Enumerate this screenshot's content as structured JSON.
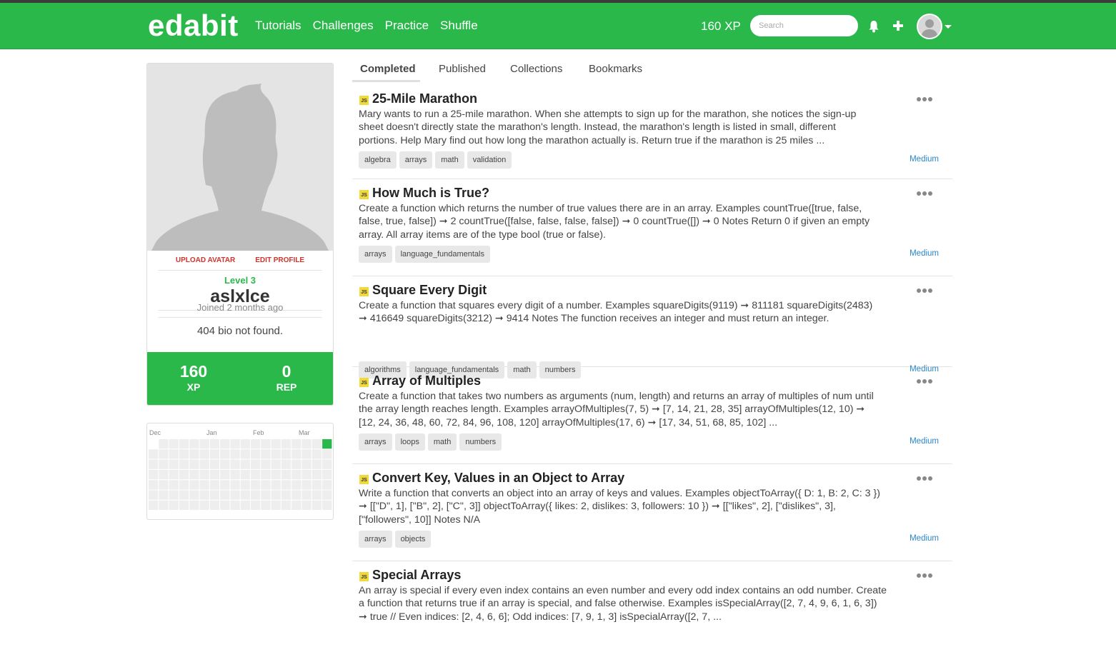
{
  "nav": {
    "logo": "edabit",
    "links": [
      "Tutorials",
      "Challenges",
      "Practice",
      "Shuffle"
    ],
    "xp": "160 XP",
    "search_placeholder": "Search"
  },
  "profile": {
    "upload_avatar": "UPLOAD AVATAR",
    "edit_profile": "EDIT PROFILE",
    "level": "Level 3",
    "username": "aslxlce",
    "joined": "Joined 2 months ago",
    "bio": "404 bio not found.",
    "xp_value": "160",
    "xp_label": "XP",
    "rep_value": "0",
    "rep_label": "REP"
  },
  "activity": {
    "months": [
      "Dec",
      "Jan",
      "Feb",
      "Mar"
    ]
  },
  "tabs": [
    "Completed",
    "Published",
    "Collections",
    "Bookmarks"
  ],
  "challenges": [
    {
      "title": "25-Mile Marathon",
      "desc_lines": [
        "Mary wants to run a 25-mile marathon. When she attempts to sign up for the marathon, she notices the sign-up",
        "sheet doesn't directly state the marathon's length. Instead, the marathon's length is listed in small, different",
        "portions. Help Mary find out how long the marathon actually is. Return true if the marathon is 25 miles ..."
      ],
      "tags": [
        "algebra",
        "arrays",
        "math",
        "validation"
      ],
      "difficulty": "Medium"
    },
    {
      "title": "How Much is True?",
      "desc_lines": [
        "Create a function which returns the number of true values there are in an array. Examples countTrue([true, false,",
        "false, true, false]) ➞ 2 countTrue([false, false, false, false]) ➞ 0 countTrue([]) ➞ 0 Notes Return 0 if given an empty",
        "array. All array items are of the type bool (true or false)."
      ],
      "tags": [
        "arrays",
        "language_fundamentals"
      ],
      "difficulty": "Medium"
    },
    {
      "title": "Square Every Digit",
      "desc_lines": [
        "Create a function that squares every digit of a number. Examples squareDigits(9119) ➞ 811181 squareDigits(2483)",
        "➞ 416649 squareDigits(3212) ➞ 9414 Notes The function receives an integer and must return an integer."
      ],
      "tags": [
        "algorithms",
        "language_fundamentals",
        "math",
        "numbers"
      ],
      "difficulty": "Medium"
    },
    {
      "title": "Array of Multiples",
      "desc_lines": [
        "Create a function that takes two numbers as arguments (num, length) and returns an array of multiples of num until",
        "the array length reaches length. Examples arrayOfMultiples(7, 5) ➞ [7, 14, 21, 28, 35] arrayOfMultiples(12, 10) ➞",
        "[12, 24, 36, 48, 60, 72, 84, 96, 108, 120] arrayOfMultiples(17, 6) ➞ [17, 34, 51, 68, 85, 102] ..."
      ],
      "tags": [
        "arrays",
        "loops",
        "math",
        "numbers"
      ],
      "difficulty": "Medium"
    },
    {
      "title": "Convert Key, Values in an Object to Array",
      "desc_lines": [
        "Write a function that converts an object into an array of keys and values. Examples objectToArray({ D: 1, B: 2, C: 3 })",
        "➞ [[\"D\", 1], [\"B\", 2], [\"C\", 3]] objectToArray({ likes: 2, dislikes: 3, followers: 10 }) ➞ [[\"likes\", 2], [\"dislikes\", 3],",
        "[\"followers\", 10]] Notes N/A"
      ],
      "tags": [
        "arrays",
        "objects"
      ],
      "difficulty": "Medium"
    },
    {
      "title": "Special Arrays",
      "desc_lines": [
        "An array is special if every even index contains an even number and every odd index contains an odd number. Create",
        "a function that returns true if an array is special, and false otherwise. Examples isSpecialArray([2, 7, 4, 9, 6, 1, 6, 3])",
        "➞ true // Even indices: [2, 4, 6, 6]; Odd indices: [7, 9, 1, 3] isSpecialArray([2, 7, ..."
      ],
      "tags": [],
      "difficulty": ""
    }
  ],
  "colors": {
    "brand_green": "#2bb84b",
    "link_blue": "#2a86c9",
    "action_red": "#d0342c",
    "js_yellow": "#f0d93a"
  }
}
